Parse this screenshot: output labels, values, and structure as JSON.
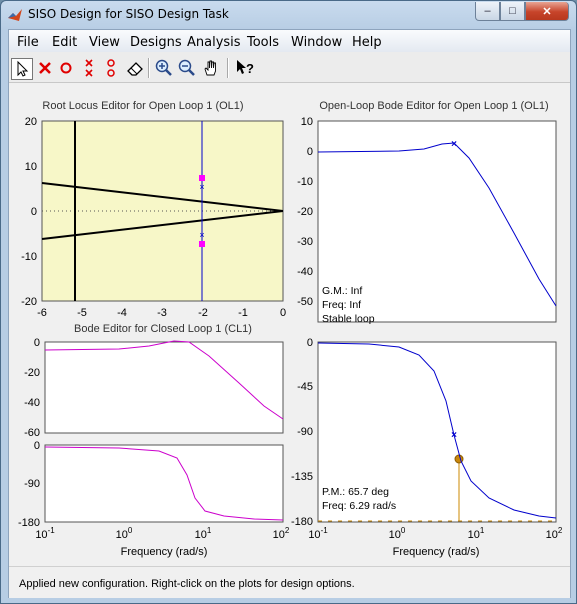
{
  "window": {
    "title": "SISO Design for SISO Design Task"
  },
  "menu": [
    "File",
    "Edit",
    "View",
    "Designs",
    "Analysis",
    "Tools",
    "Window",
    "Help"
  ],
  "toolbar": {
    "help_glyph": "?"
  },
  "status": "Applied new configuration. Right-click on the plots for design options.",
  "colors": {
    "plot_blue": "#0000cc",
    "plot_magenta": "#cc00cc",
    "root_locus_bg": "#f7f7c8",
    "marker_magenta": "#ff00ff",
    "margin_orange": "#cc8800"
  },
  "root_locus": {
    "title": "Root Locus Editor for Open Loop 1 (OL1)",
    "xticks": [
      "-6",
      "-5",
      "-4",
      "-3",
      "-2",
      "-1",
      "0"
    ],
    "yticks": [
      "20",
      "10",
      "0",
      "-10",
      "-20"
    ],
    "xlim": [
      -6,
      0
    ],
    "ylim": [
      -20,
      20
    ]
  },
  "ol_bode": {
    "title": "Open-Loop Bode Editor for Open Loop 1 (OL1)",
    "mag_yticks": [
      "10",
      "0",
      "-10",
      "-20",
      "-30",
      "-40",
      "-50"
    ],
    "mag_ylim": [
      -52,
      10
    ],
    "gm_label": "G.M.: Inf",
    "gm_freq": "Freq: Inf",
    "stable": "Stable loop",
    "phase_yticks": [
      "0",
      "-45",
      "-90",
      "-135",
      "-180"
    ],
    "phase_ylim": [
      -180,
      0
    ],
    "pm_label": "P.M.: 65.7 deg",
    "pm_freq": "Freq: 6.29 rad/s",
    "xlabel": "Frequency (rad/s)"
  },
  "cl_bode": {
    "title": "Bode Editor for Closed Loop 1 (CL1)",
    "mag_yticks": [
      "0",
      "-20",
      "-40",
      "-60"
    ],
    "mag_ylim": [
      -60,
      0
    ],
    "phase_yticks": [
      "0",
      "-90",
      "-180"
    ],
    "phase_ylim": [
      -180,
      0
    ],
    "xlabel": "Frequency (rad/s)"
  },
  "freq_ticks": {
    "base": "10",
    "exps": [
      "-1",
      "0",
      "1",
      "2"
    ]
  }
}
